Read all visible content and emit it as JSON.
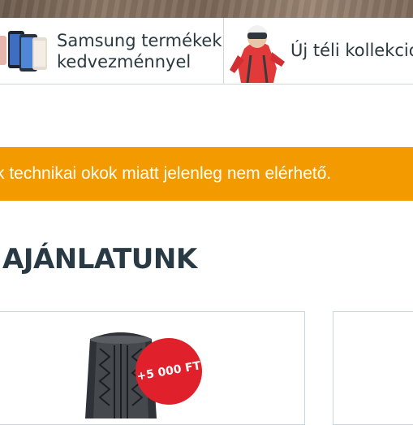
{
  "promos": [
    {
      "label_line1": "Samsung termékek",
      "label_line2": "kedvezménnyel",
      "icon": "smartphones-icon"
    },
    {
      "label": "Új téli kollekció",
      "icon": "skier-photo"
    }
  ],
  "alert": {
    "text": "k technikai okok miatt jelenleg nem elérhető.",
    "color": "#f29a00"
  },
  "section": {
    "title": "AJÁNLATUNK"
  },
  "products": [
    {
      "badge": "+5 000 FT",
      "image": "tire-image"
    }
  ],
  "colors": {
    "accent_orange": "#f29a00",
    "badge_red": "#e0202a",
    "heading": "#293a45",
    "border": "#c9d6df"
  }
}
